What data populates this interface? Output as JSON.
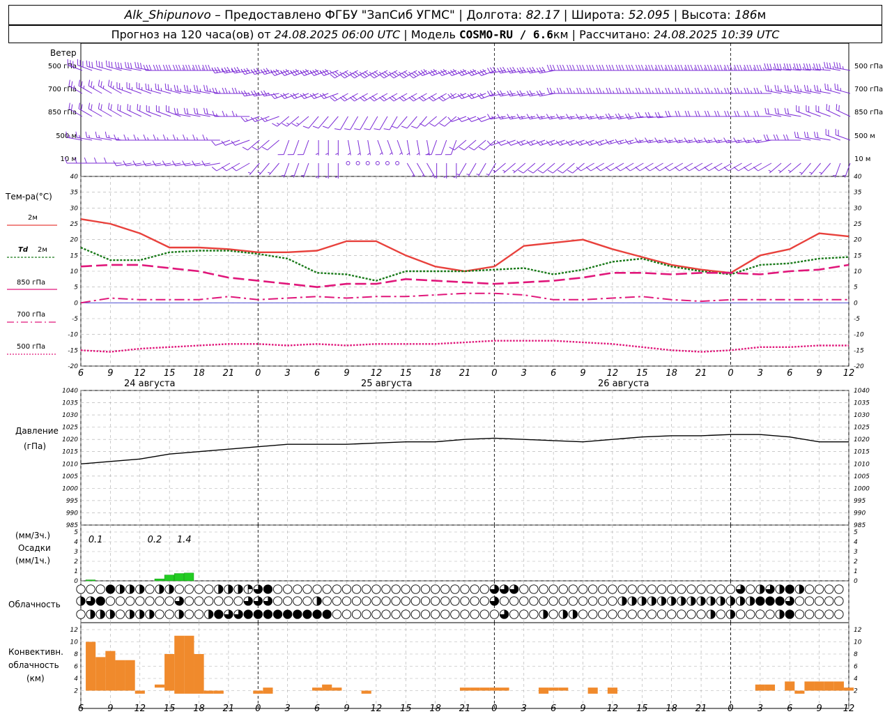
{
  "header": {
    "station": "Alk_Shipunovo",
    "provider": " – Предоставлено ФГБУ \"ЗапСиб УГМС\" | Долгота: ",
    "lon": "82.17",
    "lat_label": " | Широта: ",
    "lat": "52.095",
    "alt_label": " | Высота: ",
    "alt": "186",
    "alt_unit": "м",
    "forecast_label": "Прогноз на 120 часа(ов) от ",
    "forecast_start": "24.08.2025 06:00 UTC",
    "model_label": " | Модель ",
    "model": "COSMO-RU / 6.6",
    "model_unit": "км",
    "calc_label": " | Рассчитано: ",
    "calc_time": "24.08.2025 10:39 UTC"
  },
  "colors": {
    "t2m": "#e8413c",
    "td2m": "#1a7a1a",
    "t850": "#e0167a",
    "t700": "#e0167a",
    "t500": "#e0167a",
    "wind": "#7b2bd6",
    "precip": "#22cc22",
    "conv": "#f08a2c",
    "grid": "#999999"
  },
  "labels": {
    "wind_title": "Ветер",
    "wind_levels": [
      "500 гПа",
      "700 гПа",
      "850 гПа",
      "500 м",
      "10  м"
    ],
    "temp_title": "Тем-ра(°C)",
    "t2m": "2м",
    "td_sym": "Td",
    "td2m": "2м",
    "t850": "850 гПа",
    "t700": "700 гПа",
    "t500": "500 гПа",
    "press_title": "Давление",
    "press_unit": "(гПа)",
    "precip_3h": "(мм/3ч.)",
    "precip_title": "Осадки",
    "precip_1h": "(мм/1ч.)",
    "cloud_title": "Облачность",
    "conv1": "Конвективн.",
    "conv2": "облачность",
    "conv3": "(км)",
    "day1": "24 августа",
    "day2": "25 августа",
    "day3": "26 августа"
  },
  "chart_data": [
    {
      "type": "line",
      "title": "Тем-ра(°C)",
      "x_hours": [
        0,
        3,
        6,
        9,
        12,
        15,
        18,
        21,
        24,
        27,
        30,
        33,
        36,
        39,
        42,
        45,
        48,
        51,
        54,
        57,
        60,
        63,
        66,
        69,
        72,
        75,
        78
      ],
      "x_tick_labels": [
        "6",
        "9",
        "12",
        "15",
        "18",
        "21",
        "0",
        "3",
        "6",
        "9",
        "12",
        "15",
        "18",
        "21",
        "0",
        "3",
        "6",
        "9",
        "12",
        "15",
        "18",
        "21",
        "0",
        "3",
        "6",
        "9",
        "12"
      ],
      "ylim": [
        -20,
        40
      ],
      "series": [
        {
          "name": "2м",
          "values": [
            26.5,
            25,
            22,
            17.5,
            17.5,
            17,
            16,
            16,
            16.5,
            19.5,
            19.5,
            15,
            11.5,
            10,
            11.5,
            18,
            19,
            20,
            17,
            14.5,
            12,
            10.5,
            9.5,
            15,
            17,
            22,
            21
          ]
        },
        {
          "name": "Td 2м",
          "values": [
            17.5,
            13.5,
            13.5,
            16,
            16.5,
            16.5,
            15.5,
            14,
            9.5,
            9,
            7,
            10,
            10,
            10,
            10.5,
            11,
            9,
            10.5,
            13,
            14,
            11.5,
            10,
            9,
            12,
            12.5,
            14,
            14.5
          ]
        },
        {
          "name": "850 гПа",
          "values": [
            11.5,
            12,
            12,
            11,
            10,
            8,
            7,
            6,
            5,
            6,
            6,
            7.5,
            7,
            6.5,
            6,
            6.5,
            7,
            8,
            9.5,
            9.5,
            9,
            9.5,
            9.5,
            9,
            10,
            10.5,
            12
          ]
        },
        {
          "name": "700 гПа",
          "values": [
            0,
            1.5,
            1,
            1,
            1,
            2,
            1,
            1.5,
            2,
            1.5,
            2,
            2,
            2.5,
            3,
            3,
            2.5,
            1,
            1,
            1.5,
            2,
            1,
            0.5,
            1,
            1,
            1,
            1,
            1
          ]
        },
        {
          "name": "500 гПа",
          "values": [
            -15,
            -15.5,
            -14.5,
            -14,
            -13.5,
            -13,
            -13,
            -13.5,
            -13,
            -13.5,
            -13,
            -13,
            -13,
            -12.5,
            -12,
            -12,
            -12,
            -12.5,
            -13,
            -14,
            -15,
            -15.5,
            -15,
            -14,
            -14,
            -13.5,
            -13.5
          ]
        }
      ]
    },
    {
      "type": "line",
      "title": "Давление",
      "ylabel": "(гПа)",
      "ylim": [
        985,
        1040
      ],
      "y_ticks": [
        985,
        990,
        995,
        1000,
        1005,
        1010,
        1015,
        1020,
        1025,
        1030,
        1035,
        1040
      ],
      "x_hours": [
        0,
        3,
        6,
        9,
        12,
        15,
        18,
        21,
        24,
        27,
        30,
        33,
        36,
        39,
        42,
        45,
        48,
        51,
        54,
        57,
        60,
        63,
        66,
        69,
        72,
        75,
        78
      ],
      "values": [
        1010,
        1011,
        1012,
        1014,
        1015,
        1016,
        1017,
        1018,
        1018,
        1018,
        1018.5,
        1019,
        1019,
        1020,
        1020.5,
        1020,
        1019.5,
        1019,
        1020,
        1021,
        1021.5,
        1021.5,
        1022,
        1022,
        1021,
        1019,
        1019
      ]
    },
    {
      "type": "bar",
      "title": "Осадки",
      "ylim": [
        0,
        5
      ],
      "y_ticks": [
        0,
        1,
        2,
        3,
        4,
        5
      ],
      "hourly_mm": [
        {
          "h": 1,
          "v": 0.1
        },
        {
          "h": 8,
          "v": 0.2
        },
        {
          "h": 9,
          "v": 0.6
        },
        {
          "h": 10,
          "v": 0.75
        },
        {
          "h": 11,
          "v": 0.8
        }
      ],
      "totals_3h": [
        {
          "h": 1.5,
          "label": "0.1"
        },
        {
          "h": 7.5,
          "label": "0.2"
        },
        {
          "h": 10.5,
          "label": "1.4"
        }
      ]
    },
    {
      "type": "table",
      "title": "Облачность",
      "note": "three cloud-cover rows, 78 hourly columns; each value is octa 0-8",
      "rows": [
        [
          0,
          0,
          0,
          8,
          4,
          4,
          4,
          0,
          4,
          4,
          0,
          0,
          0,
          0,
          4,
          4,
          4,
          2,
          6,
          8,
          0,
          0,
          0,
          0,
          0,
          0,
          0,
          0,
          0,
          0,
          0,
          0,
          0,
          0,
          0,
          0,
          0,
          0,
          0,
          0,
          0,
          0,
          6,
          6,
          6,
          0,
          0,
          0,
          0,
          0,
          0,
          0,
          0,
          0,
          0,
          0,
          0,
          0,
          0,
          0,
          0,
          0,
          0,
          0,
          0,
          0,
          0,
          6,
          0,
          4,
          6,
          4,
          8,
          4,
          0,
          0,
          0,
          0
        ],
        [
          4,
          6,
          8,
          0,
          0,
          0,
          0,
          0,
          0,
          0,
          6,
          0,
          0,
          0,
          0,
          0,
          0,
          6,
          6,
          6,
          0,
          0,
          0,
          0,
          4,
          0,
          0,
          0,
          0,
          0,
          0,
          0,
          0,
          0,
          0,
          0,
          0,
          0,
          0,
          0,
          0,
          0,
          6,
          0,
          0,
          0,
          0,
          0,
          0,
          0,
          0,
          0,
          0,
          0,
          0,
          4,
          4,
          4,
          4,
          4,
          4,
          4,
          4,
          4,
          4,
          4,
          4,
          4,
          4,
          8,
          8,
          8,
          6,
          0,
          0,
          0,
          0,
          0
        ],
        [
          0,
          4,
          4,
          4,
          0,
          4,
          4,
          4,
          0,
          0,
          4,
          0,
          0,
          4,
          8,
          6,
          6,
          8,
          8,
          8,
          8,
          8,
          8,
          8,
          8,
          8,
          0,
          0,
          0,
          0,
          0,
          0,
          0,
          0,
          0,
          0,
          0,
          0,
          0,
          0,
          0,
          0,
          0,
          6,
          0,
          0,
          0,
          4,
          0,
          4,
          4,
          0,
          0,
          0,
          0,
          0,
          0,
          0,
          0,
          0,
          0,
          0,
          0,
          0,
          4,
          0,
          4,
          0,
          0,
          0,
          0,
          4,
          8,
          0,
          0,
          0,
          0,
          0
        ]
      ]
    },
    {
      "type": "bar",
      "title": "Конвективн. облачность",
      "ylabel": "(км)",
      "ylim": [
        0,
        12
      ],
      "y_ticks": [
        2,
        4,
        6,
        8,
        10,
        12
      ],
      "bars": [
        {
          "h": 1,
          "base": 2,
          "top": 10
        },
        {
          "h": 2,
          "base": 2,
          "top": 7.5
        },
        {
          "h": 3,
          "base": 2,
          "top": 8.5
        },
        {
          "h": 4,
          "base": 2,
          "top": 7
        },
        {
          "h": 5,
          "base": 2,
          "top": 7
        },
        {
          "h": 6,
          "base": 1.5,
          "top": 2
        },
        {
          "h": 8,
          "base": 2.5,
          "top": 3
        },
        {
          "h": 9,
          "base": 2,
          "top": 8
        },
        {
          "h": 10,
          "base": 1.5,
          "top": 11
        },
        {
          "h": 11,
          "base": 1.5,
          "top": 11
        },
        {
          "h": 12,
          "base": 1.5,
          "top": 8
        },
        {
          "h": 13,
          "base": 1.5,
          "top": 2
        },
        {
          "h": 14,
          "base": 1.5,
          "top": 2
        },
        {
          "h": 18,
          "base": 1.5,
          "top": 2
        },
        {
          "h": 19,
          "base": 1.5,
          "top": 2.5
        },
        {
          "h": 24,
          "base": 2,
          "top": 2.5
        },
        {
          "h": 25,
          "base": 2,
          "top": 3
        },
        {
          "h": 26,
          "base": 2,
          "top": 2.5
        },
        {
          "h": 29,
          "base": 1.5,
          "top": 2
        },
        {
          "h": 39,
          "base": 2,
          "top": 2.5
        },
        {
          "h": 40,
          "base": 2,
          "top": 2.5
        },
        {
          "h": 41,
          "base": 2,
          "top": 2.5
        },
        {
          "h": 42,
          "base": 2,
          "top": 2.5
        },
        {
          "h": 43,
          "base": 2,
          "top": 2.5
        },
        {
          "h": 47,
          "base": 1.5,
          "top": 2.5
        },
        {
          "h": 48,
          "base": 2,
          "top": 2.5
        },
        {
          "h": 49,
          "base": 2,
          "top": 2.5
        },
        {
          "h": 52,
          "base": 1.5,
          "top": 2.5
        },
        {
          "h": 54,
          "base": 1.5,
          "top": 2.5
        },
        {
          "h": 69,
          "base": 2,
          "top": 3
        },
        {
          "h": 70,
          "base": 2,
          "top": 3
        },
        {
          "h": 72,
          "base": 2,
          "top": 3.5
        },
        {
          "h": 73,
          "base": 1.5,
          "top": 2
        },
        {
          "h": 74,
          "base": 2,
          "top": 3.5
        },
        {
          "h": 75,
          "base": 2,
          "top": 3.5
        },
        {
          "h": 76,
          "base": 2,
          "top": 3.5
        },
        {
          "h": 77,
          "base": 2,
          "top": 3.5
        },
        {
          "h": 78,
          "base": 2,
          "top": 2.5
        }
      ]
    },
    {
      "type": "scatter",
      "title": "Ветер",
      "note": "wind barbs every hour at 5 levels; direction (deg from) and speed (m/s)",
      "levels": [
        "500 гПа",
        "700 гПа",
        "850 гПа",
        "500 м",
        "10  м"
      ],
      "dir": [
        [
          290,
          285,
          280,
          270,
          270,
          260,
          255,
          250,
          250,
          240,
          240,
          240,
          250,
          250,
          260,
          260,
          270,
          270,
          270,
          270,
          270,
          270,
          270,
          275,
          275,
          280
        ],
        [
          300,
          300,
          290,
          285,
          280,
          270,
          260,
          250,
          250,
          240,
          240,
          240,
          240,
          250,
          260,
          260,
          270,
          270,
          270,
          270,
          270,
          270,
          270,
          280,
          280,
          285
        ],
        [
          300,
          300,
          295,
          290,
          280,
          270,
          250,
          230,
          220,
          210,
          210,
          220,
          230,
          250,
          260,
          260,
          260,
          260,
          260,
          265,
          270,
          270,
          270,
          280,
          290,
          295
        ],
        [
          280,
          280,
          270,
          270,
          270,
          250,
          230,
          200,
          180,
          170,
          160,
          170,
          200,
          230,
          250,
          250,
          250,
          250,
          255,
          260,
          260,
          260,
          260,
          270,
          280,
          290
        ],
        [
          270,
          270,
          260,
          260,
          260,
          240,
          220,
          200,
          180,
          160,
          150,
          150,
          180,
          210,
          230,
          230,
          230,
          240,
          240,
          240,
          240,
          240,
          240,
          230,
          220,
          200
        ]
      ],
      "speed": [
        [
          15,
          15,
          16,
          16,
          17,
          17,
          17,
          18,
          18,
          18,
          18,
          17,
          16,
          16,
          16,
          15,
          15,
          16,
          16,
          17,
          17,
          17,
          17,
          17,
          17,
          17
        ],
        [
          12,
          12,
          12,
          12,
          12,
          12,
          12,
          11,
          10,
          10,
          10,
          10,
          10,
          10,
          11,
          11,
          12,
          12,
          12,
          12,
          12,
          12,
          12,
          12,
          12,
          12
        ],
        [
          10,
          10,
          10,
          10,
          9,
          8,
          8,
          7,
          6,
          5,
          5,
          5,
          6,
          6,
          7,
          8,
          8,
          8,
          9,
          9,
          9,
          9,
          9,
          10,
          10,
          10
        ],
        [
          8,
          8,
          8,
          7,
          7,
          6,
          6,
          5,
          3,
          2,
          2,
          3,
          4,
          5,
          6,
          7,
          8,
          8,
          8,
          8,
          8,
          8,
          8,
          9,
          9,
          9
        ],
        [
          5,
          5,
          5,
          5,
          4,
          4,
          3,
          3,
          2,
          1,
          1,
          2,
          2,
          3,
          3,
          4,
          4,
          4,
          4,
          4,
          4,
          4,
          4,
          3,
          3,
          3
        ]
      ]
    }
  ]
}
